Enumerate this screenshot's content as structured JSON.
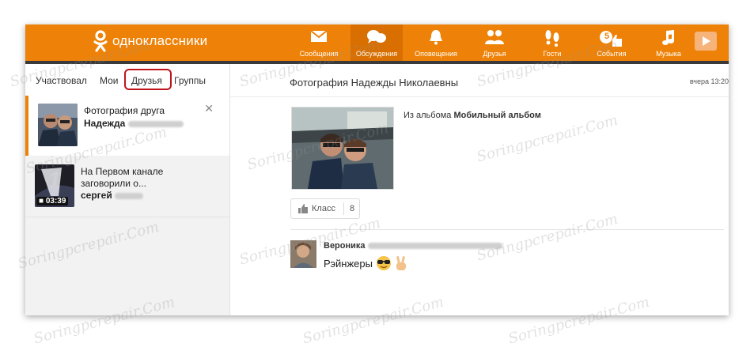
{
  "brand": {
    "name": "одноклассники"
  },
  "nav": [
    {
      "label": "Сообщения",
      "icon": "envelope-icon"
    },
    {
      "label": "Обсуждения",
      "icon": "chat-bubbles-icon"
    },
    {
      "label": "Оповещения",
      "icon": "bell-icon"
    },
    {
      "label": "Друзья",
      "icon": "friends-icon"
    },
    {
      "label": "Гости",
      "icon": "footprints-icon"
    },
    {
      "label": "События",
      "icon": "thumb-up-icon",
      "badge": "5"
    },
    {
      "label": "Музыка",
      "icon": "music-note-icon"
    }
  ],
  "subtabs": [
    "Участвовал",
    "Мои",
    "Друзья",
    "Группы"
  ],
  "discussions": [
    {
      "title": "Фотография друга",
      "author": "Надежда"
    },
    {
      "title": "На Первом канале заговорили о...",
      "author": "сергей",
      "duration": "03:39",
      "channel_logo": "1"
    }
  ],
  "main": {
    "title": "Фотография Надежды Николаевны",
    "time": "вчера 13:20",
    "album_prefix": "Из альбома",
    "album_name": "Мобильный альбом",
    "like_label": "Класс",
    "like_count": "8",
    "comment": {
      "author": "Вероника",
      "text": "Рэйнжеры"
    }
  },
  "watermark": "Soringpcrepair.Com",
  "colors": {
    "accent": "#ee8208",
    "highlight": "#c0141b"
  }
}
